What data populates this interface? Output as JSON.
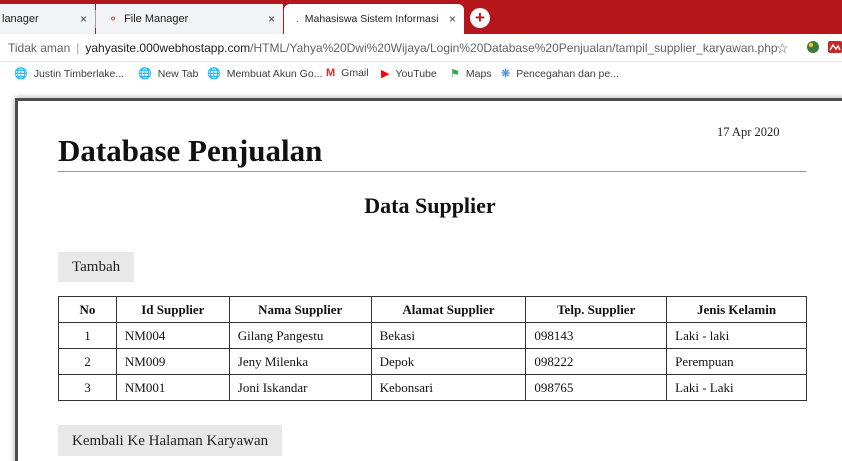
{
  "browser": {
    "tabs": [
      {
        "label": "lanager",
        "active": false
      },
      {
        "label": "File Manager",
        "active": false
      },
      {
        "label": "Mahasiswa Sistem Informasi",
        "active": true
      }
    ],
    "new_tab_symbol": "+",
    "close_symbol": "×",
    "address": {
      "security": "Tidak aman",
      "host": "yahyasite.000webhostapp.com",
      "path": "/HTML/Yahya%20Dwi%20Wijaya/Login%20Database%20Penjualan/tampil_supplier_karyawan.php"
    },
    "icons": [
      "star-icon",
      "extension-icon",
      "profile-icon"
    ],
    "bookmarks": [
      {
        "label": "Justin Timberlake...",
        "icon": "globe-icon"
      },
      {
        "label": "New Tab",
        "icon": "globe-icon"
      },
      {
        "label": "Membuat Akun Go...",
        "icon": "globe-icon"
      },
      {
        "label": "Gmail",
        "icon": "gmail-icon"
      },
      {
        "label": "YouTube",
        "icon": "youtube-icon"
      },
      {
        "label": "Maps",
        "icon": "maps-icon"
      },
      {
        "label": "Pencegahan dan pe...",
        "icon": "shield-icon"
      }
    ]
  },
  "page": {
    "date": "17 Apr 2020",
    "title": "Database Penjualan",
    "subtitle": "Data Supplier",
    "add_button": "Tambah",
    "back_button": "Kembali Ke Halaman Karyawan",
    "table": {
      "headers": [
        "No",
        "Id Supplier",
        "Nama Supplier",
        "Alamat Supplier",
        "Telp. Supplier",
        "Jenis Kelamin"
      ],
      "rows": [
        [
          "1",
          "NM004",
          "Gilang Pangestu",
          "Bekasi",
          "098143",
          "Laki - laki"
        ],
        [
          "2",
          "NM009",
          "Jeny Milenka",
          "Depok",
          "098222",
          "Perempuan"
        ],
        [
          "3",
          "NM001",
          "Joni Iskandar",
          "Kebonsari",
          "098765",
          "Laki - Laki"
        ]
      ]
    }
  },
  "colors": {
    "tab_strip": "#b5161c",
    "button_bg": "#e8e8e8"
  }
}
